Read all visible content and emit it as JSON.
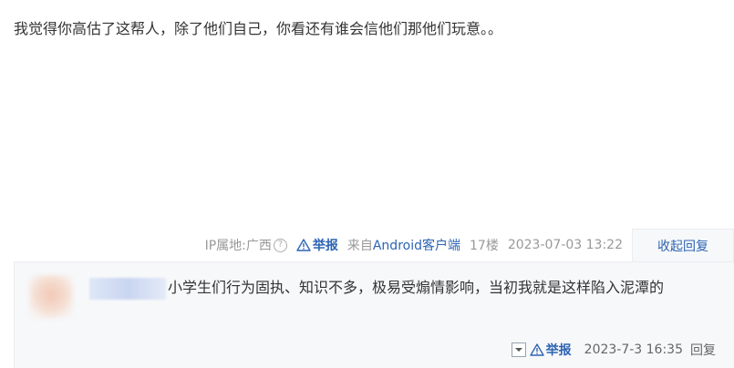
{
  "post": {
    "content": "我觉得你高估了这帮人，除了他们自己，你看还有谁会信他们那他们玩意。。"
  },
  "meta": {
    "ip_location": "IP属地:广西",
    "help_icon": "question-circle-icon",
    "report_label": "举报",
    "report_icon": "warning-triangle-icon",
    "source_prefix": "来自",
    "source_client": "Android客户端",
    "floor": "17楼",
    "timestamp": "2023-07-03 13:22",
    "toggle_reply_label": "收起回复"
  },
  "reply": {
    "text": "小学生们行为固执、知识不多，极易受煽情影响，当初我就是这样陷入泥潭的",
    "report_label": "举报",
    "time": "2023-7-3 16:35",
    "reply_label": "回复",
    "dropdown_icon": "chevron-down-icon"
  },
  "colors": {
    "link_blue": "#2d64b3",
    "meta_gray": "#999999",
    "reply_bg": "#f7f8fa"
  }
}
